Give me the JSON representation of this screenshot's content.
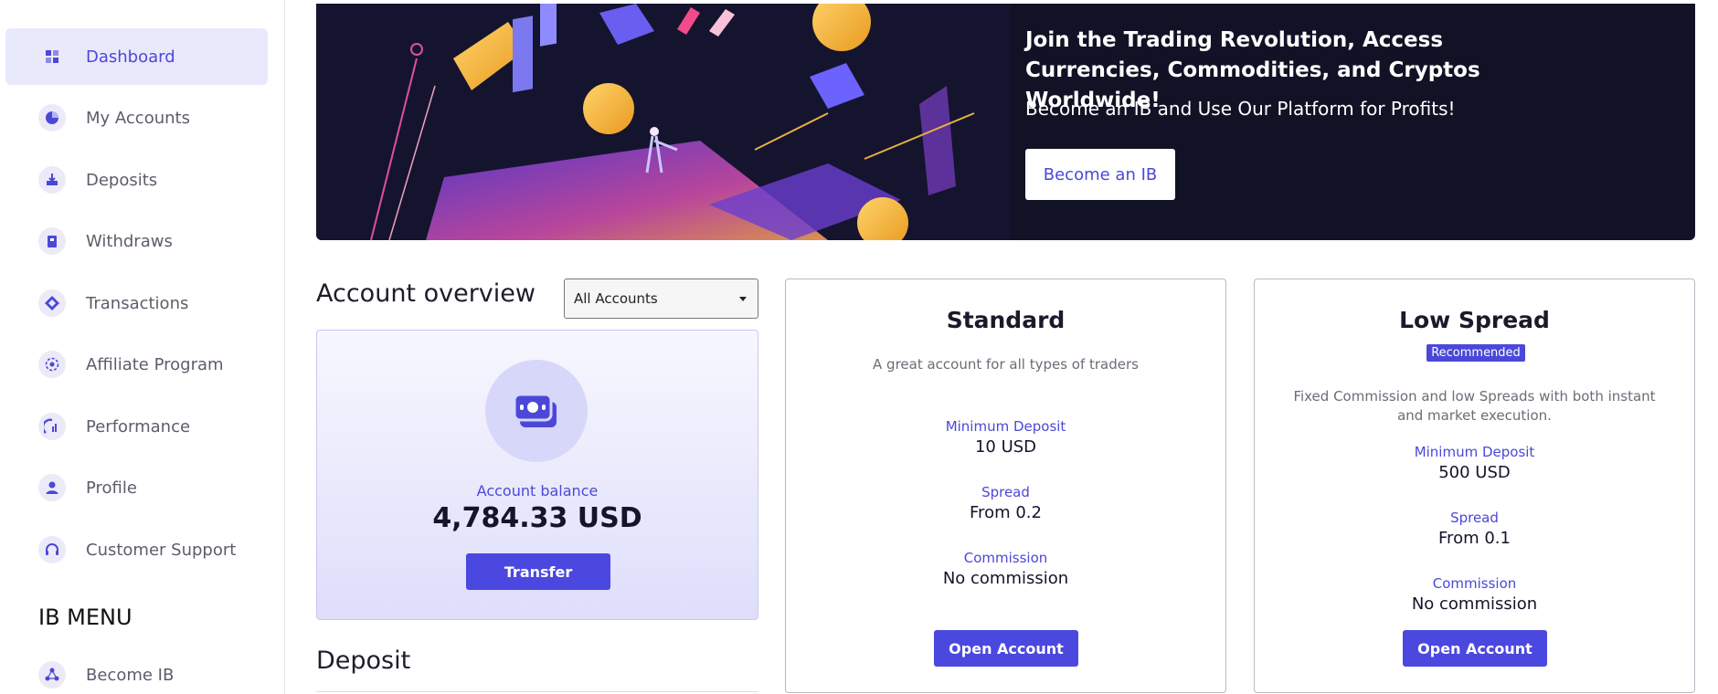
{
  "sidebar": {
    "items": [
      {
        "label": "Dashboard",
        "icon": "dashboard-icon",
        "active": true
      },
      {
        "label": "My Accounts",
        "icon": "pie-chart-icon"
      },
      {
        "label": "Deposits",
        "icon": "deposit-icon"
      },
      {
        "label": "Withdraws",
        "icon": "withdraw-icon"
      },
      {
        "label": "Transactions",
        "icon": "transactions-icon"
      },
      {
        "label": "Affiliate Program",
        "icon": "affiliate-icon"
      },
      {
        "label": "Performance",
        "icon": "performance-icon"
      },
      {
        "label": "Profile",
        "icon": "user-icon"
      },
      {
        "label": "Customer Support",
        "icon": "headset-icon"
      }
    ],
    "ib_heading": "IB MENU",
    "ib_items": [
      {
        "label": "Become IB",
        "icon": "network-icon"
      }
    ]
  },
  "banner": {
    "title": "Join the Trading Revolution, Access Currencies, Commodities, and Cryptos Worldwide!",
    "subtitle": "Become an IB and Use Our Platform for Profits!",
    "button": "Become an IB"
  },
  "overview": {
    "title": "Account overview",
    "select_value": "All Accounts",
    "balance_label": "Account balance",
    "balance_value": "4,784.33 USD",
    "transfer_button": "Transfer"
  },
  "deposit_title": "Deposit",
  "plans": [
    {
      "name": "Standard",
      "description": "A great account for all types of traders",
      "min_deposit_label": "Minimum Deposit",
      "min_deposit": "10 USD",
      "spread_label": "Spread",
      "spread": "From 0.2",
      "commission_label": "Commission",
      "commission": "No commission",
      "button": "Open Account"
    },
    {
      "name": "Low Spread",
      "badge": "Recommended",
      "description": "Fixed Commission and low Spreads with both instant and market execution.",
      "min_deposit_label": "Minimum Deposit",
      "min_deposit": "500 USD",
      "spread_label": "Spread",
      "spread": "From 0.1",
      "commission_label": "Commission",
      "commission": "No commission",
      "button": "Open Account"
    }
  ],
  "colors": {
    "accent": "#4b48d8",
    "active_bg": "#e9e9fc",
    "banner_bg": "#121226"
  }
}
